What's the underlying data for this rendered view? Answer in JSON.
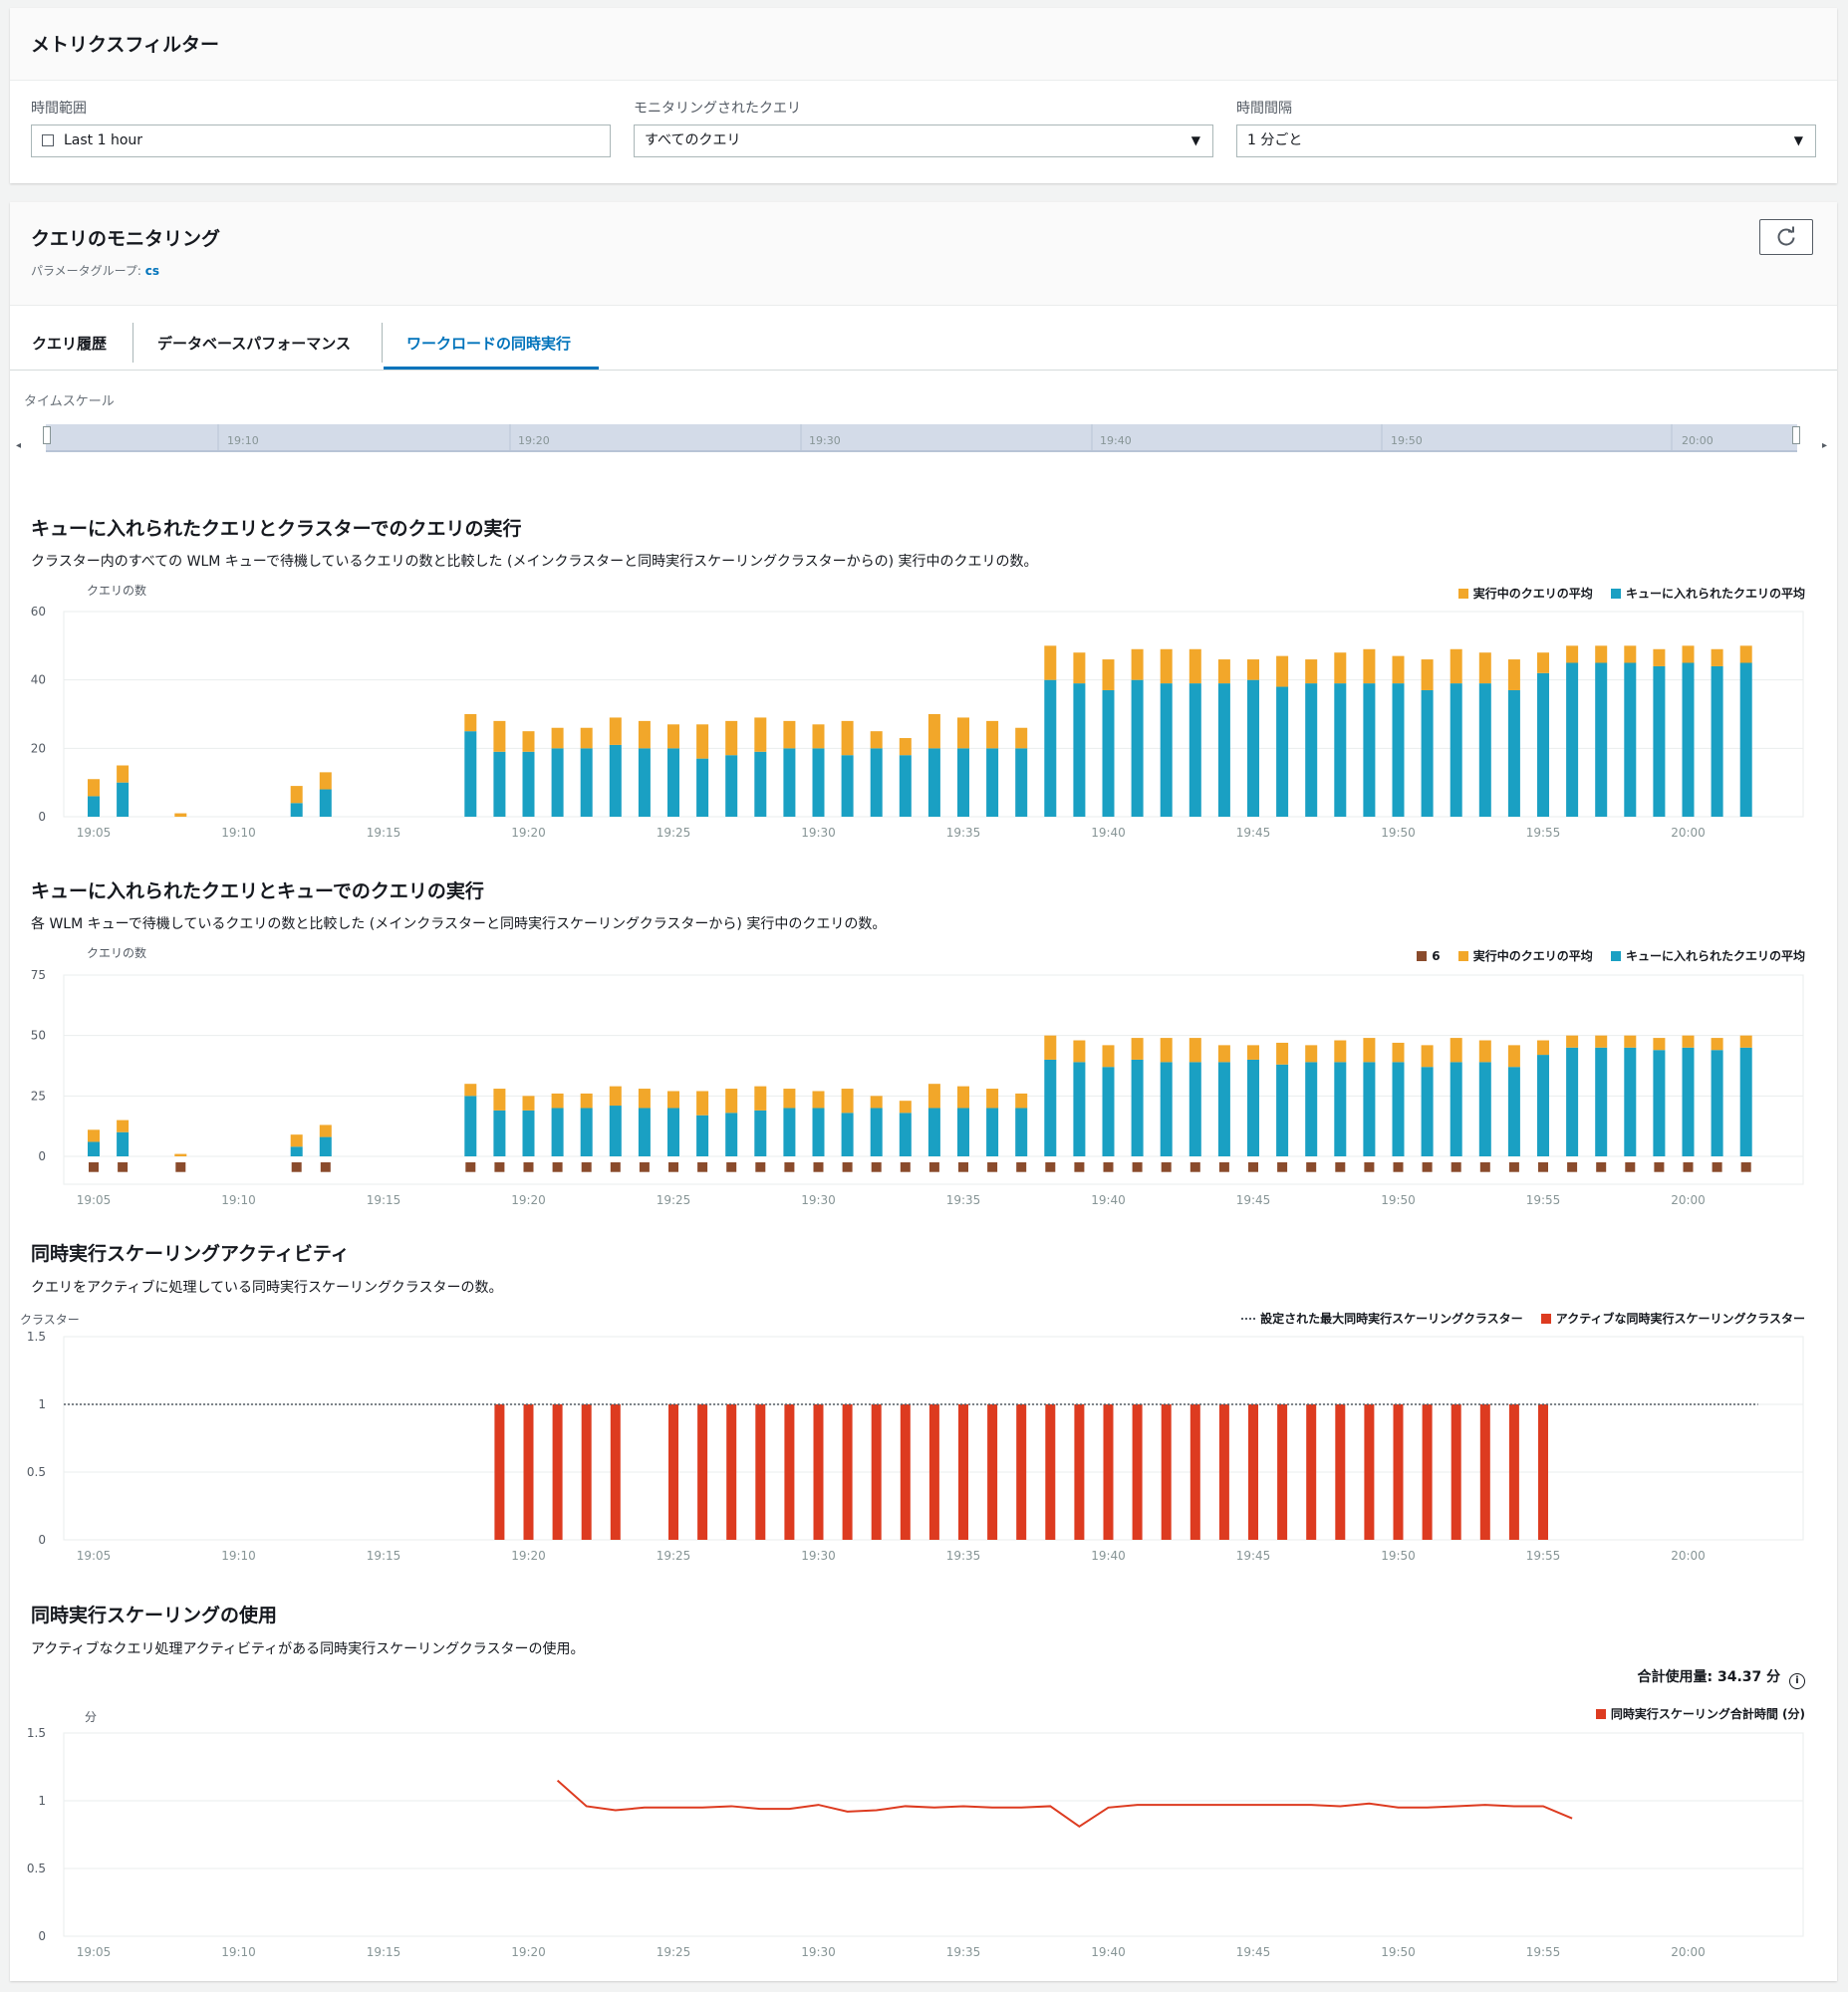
{
  "filters": {
    "title": "メトリクスフィルター",
    "time_range": {
      "label": "時間範囲",
      "value": "Last 1 hour"
    },
    "monitored_queries": {
      "label": "モニタリングされたクエリ",
      "value": "すべてのクエリ"
    },
    "interval": {
      "label": "時間間隔",
      "value": "1 分ごと"
    }
  },
  "monitoring": {
    "title": "クエリのモニタリング",
    "param_label": "パラメータグループ: ",
    "param_value": "cs",
    "tabs": [
      {
        "label": "クエリ履歴",
        "active": false
      },
      {
        "label": "データベースパフォーマンス",
        "active": false
      },
      {
        "label": "ワークロードの同時実行",
        "active": true
      }
    ]
  },
  "timescale": {
    "label": "タイムスケール",
    "ticks": [
      "19:10",
      "19:20",
      "19:30",
      "19:40",
      "19:50",
      "20:00"
    ]
  },
  "colors": {
    "running": "#f2a72a",
    "queued": "#1aa0c3",
    "six": "#8a4b2c",
    "active_cluster": "#dd3b20",
    "usage_line": "#dd3b20",
    "link": "#0073bb"
  },
  "charts": {
    "cluster": {
      "title": "キューに入れられたクエリとクラスターでのクエリの実行",
      "description": "クラスター内のすべての WLM キューで待機しているクエリの数と比較した (メインクラスターと同時実行スケーリングクラスターからの) 実行中のクエリの数。",
      "ylabel": "クエリの数",
      "legend": [
        "実行中のクエリの平均",
        "キューに入れられたクエリの平均"
      ]
    },
    "queue": {
      "title": "キューに入れられたクエリとキューでのクエリの実行",
      "description": "各 WLM キューで待機しているクエリの数と比較した (メインクラスターと同時実行スケーリングクラスターから) 実行中のクエリの数。",
      "ylabel": "クエリの数",
      "legend": [
        "6",
        "実行中のクエリの平均",
        "キューに入れられたクエリの平均"
      ]
    },
    "activity": {
      "title": "同時実行スケーリングアクティビティ",
      "description": "クエリをアクティブに処理している同時実行スケーリングクラスターの数。",
      "ylabel": "クラスター",
      "legend": [
        "設定された最大同時実行スケーリングクラスター",
        "アクティブな同時実行スケーリングクラスター"
      ]
    },
    "usage": {
      "title": "同時実行スケーリングの使用",
      "description": "アクティブなクエリ処理アクティビティがある同時実行スケーリングクラスターの使用。",
      "total_label": "合計使用量: 34.37 分",
      "ylabel": "分",
      "legend": [
        "同時実行スケーリング合計時間 (分)"
      ]
    }
  },
  "chart_data": [
    {
      "type": "bar",
      "title": "キューに入れられたクエリとクラスターでのクエリの実行",
      "ylabel": "クエリの数",
      "ylim": [
        0,
        60
      ],
      "yticks": [
        0,
        20,
        40,
        60
      ],
      "xticks": [
        "19:05",
        "19:10",
        "19:15",
        "19:20",
        "19:25",
        "19:30",
        "19:35",
        "19:40",
        "19:45",
        "19:50",
        "19:55",
        "20:00"
      ],
      "x": [
        "19:05",
        "19:06",
        "19:08",
        "19:12",
        "19:13",
        "19:18",
        "19:19",
        "19:20",
        "19:21",
        "19:22",
        "19:23",
        "19:24",
        "19:25",
        "19:26",
        "19:27",
        "19:28",
        "19:29",
        "19:30",
        "19:31",
        "19:32",
        "19:33",
        "19:34",
        "19:35",
        "19:36",
        "19:37",
        "19:38",
        "19:39",
        "19:40",
        "19:41",
        "19:42",
        "19:43",
        "19:44",
        "19:45",
        "19:46",
        "19:47",
        "19:48",
        "19:49",
        "19:50",
        "19:51",
        "19:52",
        "19:53",
        "19:54",
        "19:55",
        "19:56",
        "19:57",
        "19:58",
        "19:59",
        "20:00",
        "20:01",
        "20:02"
      ],
      "series": [
        {
          "name": "キューに入れられたクエリの平均",
          "values": [
            6,
            10,
            0,
            4,
            8,
            25,
            19,
            19,
            20,
            20,
            21,
            20,
            20,
            17,
            18,
            19,
            20,
            20,
            18,
            20,
            18,
            20,
            20,
            20,
            20,
            40,
            39,
            37,
            40,
            39,
            39,
            39,
            40,
            38,
            39,
            39,
            39,
            39,
            37,
            39,
            39,
            37,
            42,
            45,
            45,
            45,
            44,
            45,
            44,
            45
          ]
        },
        {
          "name": "実行中のクエリの平均",
          "values": [
            5,
            5,
            1,
            5,
            5,
            5,
            9,
            6,
            6,
            6,
            8,
            8,
            7,
            10,
            10,
            10,
            8,
            7,
            10,
            5,
            5,
            10,
            9,
            8,
            6,
            10,
            9,
            9,
            9,
            10,
            10,
            7,
            6,
            9,
            7,
            9,
            10,
            8,
            9,
            10,
            9,
            9,
            6,
            5,
            5,
            5,
            5,
            5,
            5,
            5
          ]
        }
      ]
    },
    {
      "type": "bar",
      "title": "キューに入れられたクエリとキューでのクエリの実行",
      "ylabel": "クエリの数",
      "ylim": [
        0,
        75
      ],
      "yticks": [
        0,
        25,
        50,
        75
      ],
      "xticks": [
        "19:05",
        "19:10",
        "19:15",
        "19:20",
        "19:25",
        "19:30",
        "19:35",
        "19:40",
        "19:45",
        "19:50",
        "19:55",
        "20:00"
      ],
      "x": [
        "19:05",
        "19:06",
        "19:08",
        "19:12",
        "19:13",
        "19:18",
        "19:19",
        "19:20",
        "19:21",
        "19:22",
        "19:23",
        "19:24",
        "19:25",
        "19:26",
        "19:27",
        "19:28",
        "19:29",
        "19:30",
        "19:31",
        "19:32",
        "19:33",
        "19:34",
        "19:35",
        "19:36",
        "19:37",
        "19:38",
        "19:39",
        "19:40",
        "19:41",
        "19:42",
        "19:43",
        "19:44",
        "19:45",
        "19:46",
        "19:47",
        "19:48",
        "19:49",
        "19:50",
        "19:51",
        "19:52",
        "19:53",
        "19:54",
        "19:55",
        "19:56",
        "19:57",
        "19:58",
        "19:59",
        "20:00",
        "20:01",
        "20:02"
      ],
      "series": [
        {
          "name": "キューに入れられたクエリの平均",
          "values": [
            6,
            10,
            0,
            4,
            8,
            25,
            19,
            19,
            20,
            20,
            21,
            20,
            20,
            17,
            18,
            19,
            20,
            20,
            18,
            20,
            18,
            20,
            20,
            20,
            20,
            40,
            39,
            37,
            40,
            39,
            39,
            39,
            40,
            38,
            39,
            39,
            39,
            39,
            37,
            39,
            39,
            37,
            42,
            45,
            45,
            45,
            44,
            45,
            44,
            45
          ]
        },
        {
          "name": "実行中のクエリの平均",
          "values": [
            5,
            5,
            1,
            5,
            5,
            5,
            9,
            6,
            6,
            6,
            8,
            8,
            7,
            10,
            10,
            10,
            8,
            7,
            10,
            5,
            5,
            10,
            9,
            8,
            6,
            10,
            9,
            9,
            9,
            10,
            10,
            7,
            6,
            9,
            7,
            9,
            10,
            8,
            9,
            10,
            9,
            9,
            6,
            5,
            5,
            5,
            5,
            5,
            5,
            5
          ]
        },
        {
          "name": "6",
          "values": [
            -4,
            -4,
            -4,
            -4,
            -4,
            -4,
            -4,
            -4,
            -4,
            -4,
            -4,
            -4,
            -4,
            -4,
            -4,
            -4,
            -4,
            -4,
            -4,
            -4,
            -4,
            -4,
            -4,
            -4,
            -4,
            -4,
            -4,
            -4,
            -4,
            -4,
            -4,
            -4,
            -4,
            -4,
            -4,
            -4,
            -4,
            -4,
            -4,
            -4,
            -4,
            -4,
            -4,
            -4,
            -4,
            -4,
            -4,
            -4,
            -4,
            -4
          ]
        }
      ]
    },
    {
      "type": "bar",
      "title": "同時実行スケーリングアクティビティ",
      "ylabel": "クラスター",
      "ylim": [
        0,
        1.5
      ],
      "yticks": [
        0,
        0.5,
        1,
        1.5
      ],
      "xticks": [
        "19:05",
        "19:10",
        "19:15",
        "19:20",
        "19:25",
        "19:30",
        "19:35",
        "19:40",
        "19:45",
        "19:50",
        "19:55",
        "20:00"
      ],
      "x": [
        "19:19",
        "19:20",
        "19:21",
        "19:22",
        "19:23",
        "19:25",
        "19:26",
        "19:27",
        "19:28",
        "19:29",
        "19:30",
        "19:31",
        "19:32",
        "19:33",
        "19:34",
        "19:35",
        "19:36",
        "19:37",
        "19:38",
        "19:39",
        "19:40",
        "19:41",
        "19:42",
        "19:43",
        "19:44",
        "19:45",
        "19:46",
        "19:47",
        "19:48",
        "19:49",
        "19:50",
        "19:51",
        "19:52",
        "19:53",
        "19:54",
        "19:55"
      ],
      "series": [
        {
          "name": "アクティブな同時実行スケーリングクラスター",
          "values": [
            1,
            1,
            1,
            1,
            1,
            1,
            1,
            1,
            1,
            1,
            1,
            1,
            1,
            1,
            1,
            1,
            1,
            1,
            1,
            1,
            1,
            1,
            1,
            1,
            1,
            1,
            1,
            1,
            1,
            1,
            1,
            1,
            1,
            1,
            1,
            1
          ]
        },
        {
          "name": "設定された最大同時実行スケーリングクラスター",
          "constant": 1,
          "x_range": [
            "19:05",
            "20:02"
          ]
        }
      ]
    },
    {
      "type": "line",
      "title": "同時実行スケーリングの使用",
      "ylabel": "分",
      "ylim": [
        0,
        1.5
      ],
      "yticks": [
        0,
        0.5,
        1,
        1.5
      ],
      "xticks": [
        "19:05",
        "19:10",
        "19:15",
        "19:20",
        "19:25",
        "19:30",
        "19:35",
        "19:40",
        "19:45",
        "19:50",
        "19:55",
        "20:00"
      ],
      "x": [
        "19:21",
        "19:22",
        "19:23",
        "19:24",
        "19:25",
        "19:26",
        "19:27",
        "19:28",
        "19:29",
        "19:30",
        "19:31",
        "19:32",
        "19:33",
        "19:34",
        "19:35",
        "19:36",
        "19:37",
        "19:38",
        "19:39",
        "19:40",
        "19:41",
        "19:42",
        "19:43",
        "19:44",
        "19:45",
        "19:46",
        "19:47",
        "19:48",
        "19:49",
        "19:50",
        "19:51",
        "19:52",
        "19:53",
        "19:54",
        "19:55",
        "19:56"
      ],
      "series": [
        {
          "name": "同時実行スケーリング合計時間 (分)",
          "values": [
            1.15,
            0.96,
            0.93,
            0.95,
            0.95,
            0.95,
            0.96,
            0.94,
            0.94,
            0.97,
            0.92,
            0.93,
            0.96,
            0.95,
            0.96,
            0.95,
            0.95,
            0.96,
            0.81,
            0.95,
            0.97,
            0.97,
            0.97,
            0.97,
            0.97,
            0.97,
            0.97,
            0.96,
            0.98,
            0.95,
            0.95,
            0.96,
            0.97,
            0.96,
            0.96,
            0.87
          ]
        }
      ]
    }
  ]
}
